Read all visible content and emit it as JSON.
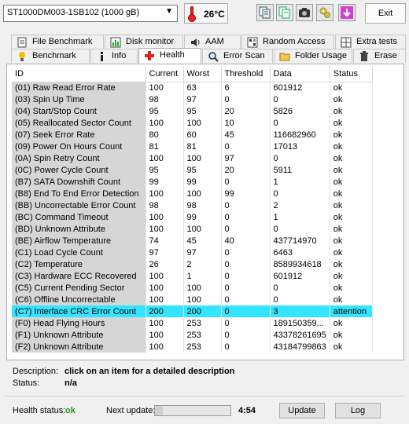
{
  "toolbar": {
    "drive": "ST1000DM003-1SB102 (1000 gB)",
    "temperature": "26°C",
    "exit_label": "Exit",
    "icons": [
      "copy-icon",
      "copy-alt-icon",
      "camera-icon",
      "tools-icon",
      "download-icon"
    ]
  },
  "tabs_top": [
    "File Benchmark",
    "Disk monitor",
    "AAM",
    "Random Access",
    "Extra tests"
  ],
  "tabs_bottom": [
    "Benchmark",
    "Info",
    "Health",
    "Error Scan",
    "Folder Usage",
    "Erase"
  ],
  "active_tab": "Health",
  "table": {
    "headers": [
      "ID",
      "Current",
      "Worst",
      "Threshold",
      "Data",
      "Status"
    ],
    "rows": [
      [
        "(01) Raw Read Error Rate",
        "100",
        "63",
        "6",
        "601912",
        "ok"
      ],
      [
        "(03) Spin Up Time",
        "98",
        "97",
        "0",
        "0",
        "ok"
      ],
      [
        "(04) Start/Stop Count",
        "95",
        "95",
        "20",
        "5826",
        "ok"
      ],
      [
        "(05) Reallocated Sector Count",
        "100",
        "100",
        "10",
        "0",
        "ok"
      ],
      [
        "(07) Seek Error Rate",
        "80",
        "60",
        "45",
        "116682960",
        "ok"
      ],
      [
        "(09) Power On Hours Count",
        "81",
        "81",
        "0",
        "17013",
        "ok"
      ],
      [
        "(0A) Spin Retry Count",
        "100",
        "100",
        "97",
        "0",
        "ok"
      ],
      [
        "(0C) Power Cycle Count",
        "95",
        "95",
        "20",
        "5911",
        "ok"
      ],
      [
        "(B7) SATA Downshift Count",
        "99",
        "99",
        "0",
        "1",
        "ok"
      ],
      [
        "(B8) End To End Error Detection",
        "100",
        "100",
        "99",
        "0",
        "ok"
      ],
      [
        "(BB) Uncorrectable Error Count",
        "98",
        "98",
        "0",
        "2",
        "ok"
      ],
      [
        "(BC) Command Timeout",
        "100",
        "99",
        "0",
        "1",
        "ok"
      ],
      [
        "(BD) Unknown Attribute",
        "100",
        "100",
        "0",
        "0",
        "ok"
      ],
      [
        "(BE) Airflow Temperature",
        "74",
        "45",
        "40",
        "437714970",
        "ok"
      ],
      [
        "(C1) Load Cycle Count",
        "97",
        "97",
        "0",
        "6463",
        "ok"
      ],
      [
        "(C2) Temperature",
        "26",
        "2",
        "0",
        "8589934618",
        "ok"
      ],
      [
        "(C3) Hardware ECC Recovered",
        "100",
        "1",
        "0",
        "601912",
        "ok"
      ],
      [
        "(C5) Current Pending Sector",
        "100",
        "100",
        "0",
        "0",
        "ok"
      ],
      [
        "(C6) Offline Uncorrectable",
        "100",
        "100",
        "0",
        "0",
        "ok"
      ],
      [
        "(C7) Interface CRC Error Count",
        "200",
        "200",
        "0",
        "3",
        "attention"
      ],
      [
        "(F0) Head Flying Hours",
        "100",
        "253",
        "0",
        "189150359...",
        "ok"
      ],
      [
        "(F1) Unknown Attribute",
        "100",
        "253",
        "0",
        "43378261695",
        "ok"
      ],
      [
        "(F2) Unknown Attribute",
        "100",
        "253",
        "0",
        "43184799863",
        "ok"
      ]
    ],
    "highlight_index": 19,
    "highlight_color": "#33e5ff"
  },
  "description": {
    "desc_label": "Description:",
    "desc_value": "click on an item for a detailed description",
    "status_label": "Status:",
    "status_value": "n/a"
  },
  "footer": {
    "health_label": "Health status:",
    "health_value": "ok",
    "next_label": "Next update:",
    "progress": 0.1,
    "countdown": "4:54",
    "update_label": "Update",
    "log_label": "Log"
  }
}
